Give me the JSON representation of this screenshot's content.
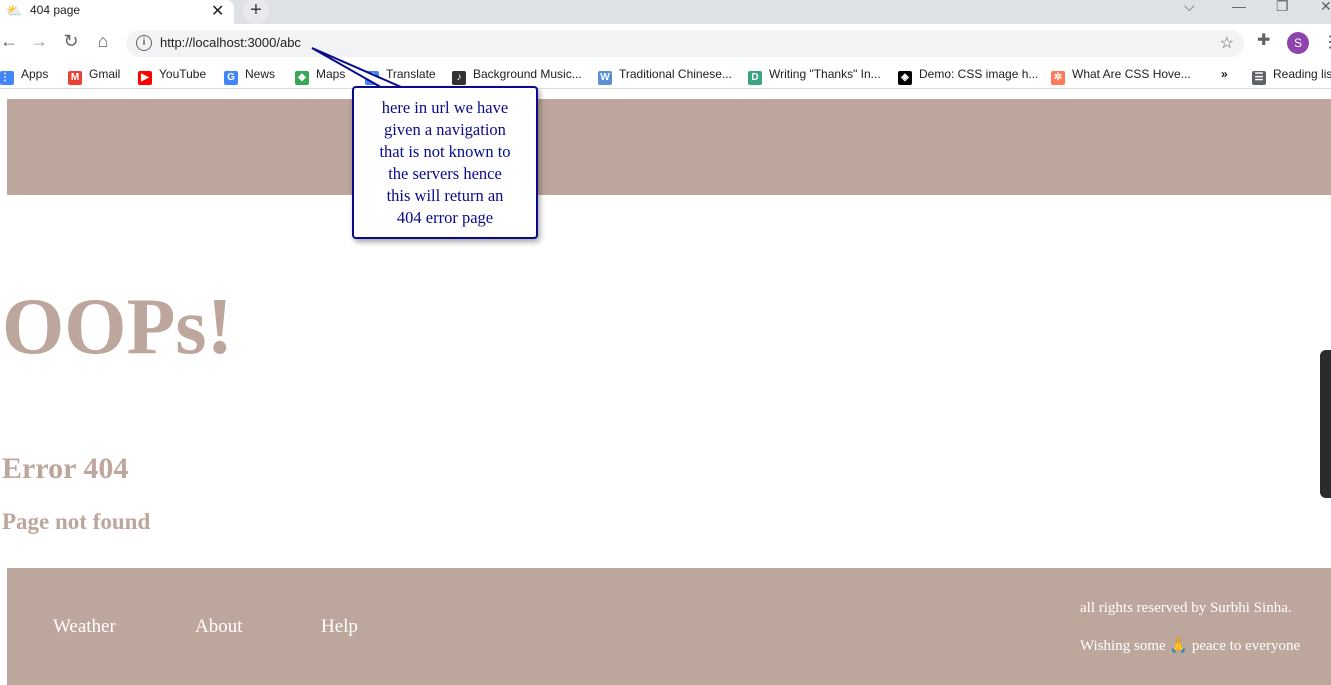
{
  "browser": {
    "tab_title": "404 page",
    "tab_close": "✕",
    "new_tab": "+",
    "url": "http://localhost:3000/abc",
    "profile_initial": "S",
    "bookmarks_overflow": "»",
    "bookmarks": [
      {
        "label": "Apps",
        "icon": "apps-grid-icon",
        "color": "#4285f4"
      },
      {
        "label": "Gmail",
        "icon": "gmail-icon",
        "color": "#ea4335"
      },
      {
        "label": "YouTube",
        "icon": "youtube-icon",
        "color": "#ff0000"
      },
      {
        "label": "News",
        "icon": "news-icon",
        "color": "#4285f4"
      },
      {
        "label": "Maps",
        "icon": "maps-icon",
        "color": "#34a853"
      },
      {
        "label": "Translate",
        "icon": "translate-icon",
        "color": "#4285f4"
      },
      {
        "label": "Background Music...",
        "icon": "music-icon",
        "color": "#333333"
      },
      {
        "label": "Traditional Chinese...",
        "icon": "w-icon",
        "color": "#5b8fd6"
      },
      {
        "label": "Writing \"Thanks\" In...",
        "icon": "d-icon",
        "color": "#3aa57f"
      },
      {
        "label": "Demo: CSS image h...",
        "icon": "codepen-icon",
        "color": "#000000"
      },
      {
        "label": "What Are CSS Hove...",
        "icon": "hubspot-icon",
        "color": "#ff7a59"
      },
      {
        "label": "Reading list",
        "icon": "reading-list-icon",
        "color": "#5f6368"
      }
    ]
  },
  "page": {
    "heading": "OOPs!",
    "error_code": "Error 404",
    "message": "Page not found",
    "accent_color": "#bda69b"
  },
  "footer": {
    "links": [
      "Weather",
      "About",
      "Help"
    ],
    "rights": "all rights reserved by Surbhi Sinha.",
    "wish_before": "Wishing some",
    "wish_emoji": "🙏",
    "wish_after": "peace to everyone"
  },
  "annotation": {
    "lines": [
      "here in url we have",
      "given a navigation",
      "that is not known to",
      "the servers hence",
      "this will return an",
      "404 error page"
    ]
  }
}
